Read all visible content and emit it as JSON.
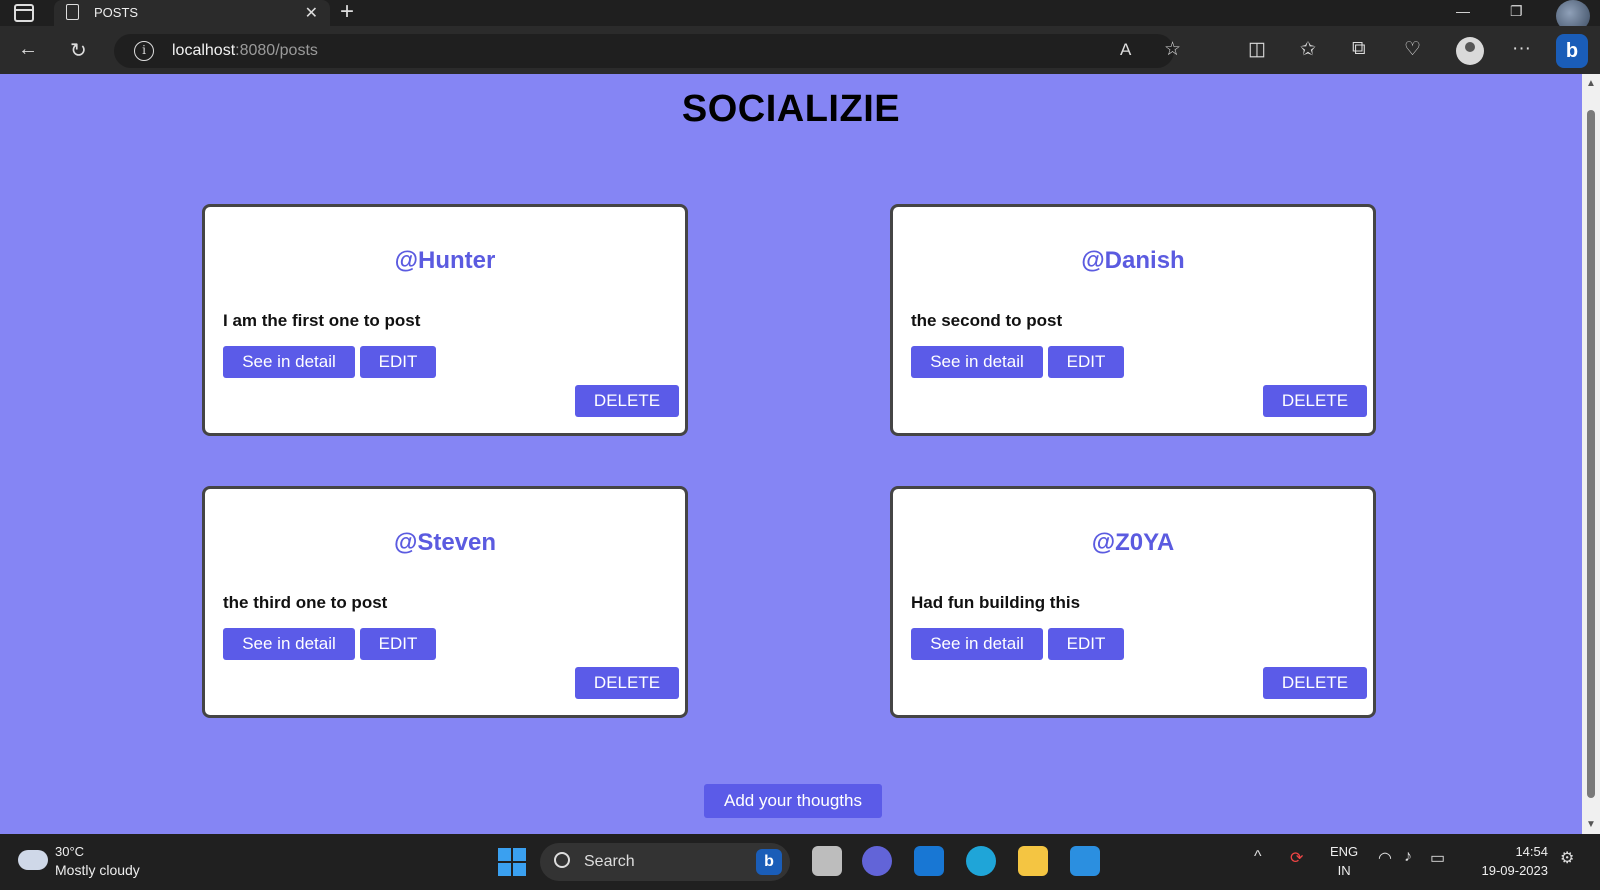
{
  "browser": {
    "tab_title": "POSTS",
    "tab_close": "✕",
    "new_tab": "+",
    "url_host": "localhost",
    "url_path": ":8080/posts",
    "window_controls": {
      "minimize": "—",
      "restore": "❐"
    },
    "read_aloud": "A",
    "more": "···"
  },
  "page": {
    "title": "SOCIALIZIE",
    "add_button": "Add your thougths",
    "colors": {
      "background": "#8585f4",
      "accent": "#5b5be8",
      "username": "#5b5be0"
    }
  },
  "posts": [
    {
      "user": "@Hunter",
      "text": "I am the first one to post",
      "detail_label": "See in detail",
      "edit_label": "EDIT",
      "delete_label": "DELETE"
    },
    {
      "user": "@Danish",
      "text": "the second to post",
      "detail_label": "See in detail",
      "edit_label": "EDIT",
      "delete_label": "DELETE"
    },
    {
      "user": "@Steven",
      "text": "the third one to post",
      "detail_label": "See in detail",
      "edit_label": "EDIT",
      "delete_label": "DELETE"
    },
    {
      "user": "@Z0YA",
      "text": "Had fun building this",
      "detail_label": "See in detail",
      "edit_label": "EDIT",
      "delete_label": "DELETE"
    }
  ],
  "taskbar": {
    "temperature": "30°C",
    "weather": "Mostly cloudy",
    "search_label": "Search",
    "lang_1": "ENG",
    "lang_2": "IN",
    "time": "14:54",
    "date": "19-09-2023"
  }
}
